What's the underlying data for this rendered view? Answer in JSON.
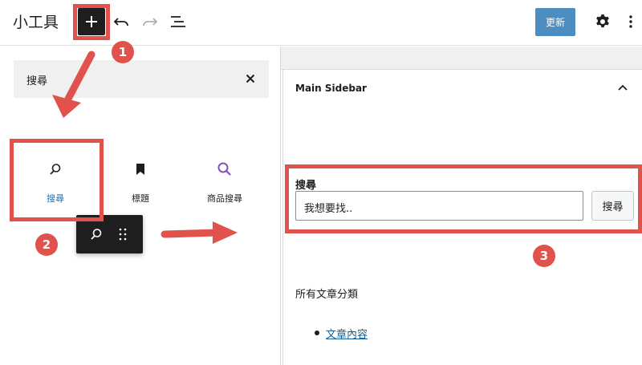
{
  "topbar": {
    "title": "小工具",
    "update_label": "更新"
  },
  "inserter": {
    "search_value": "搜尋",
    "blocks": [
      {
        "label": "搜尋",
        "icon": "search-icon",
        "selected": true
      },
      {
        "label": "標題",
        "icon": "bookmark-icon",
        "selected": false
      },
      {
        "label": "商品搜尋",
        "icon": "product-search-icon",
        "selected": false
      }
    ]
  },
  "sidebar": {
    "title": "Main Sidebar",
    "search_widget": {
      "label": "搜尋",
      "input_value": "我想要找..",
      "button_label": "搜尋"
    },
    "categories": {
      "title": "所有文章分類",
      "items": [
        "文章內容"
      ]
    }
  },
  "annotations": {
    "badges": [
      "1",
      "2",
      "3"
    ],
    "highlight_color": "#e0524b"
  },
  "colors": {
    "accent": "#2271b1",
    "toolbar_dark": "#1e1e1e",
    "product_search_icon": "#7f54b3"
  }
}
